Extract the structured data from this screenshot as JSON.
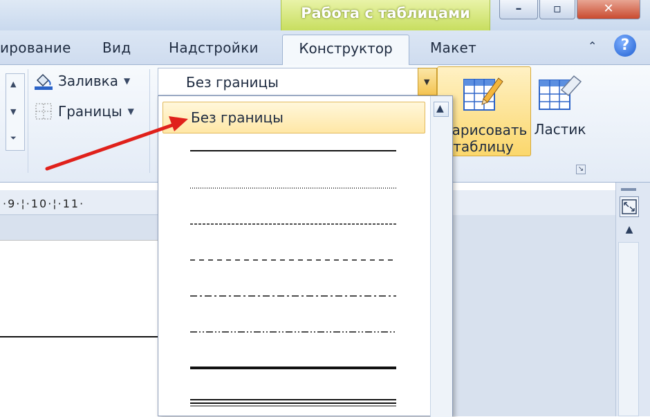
{
  "window": {
    "context_title": "Работа с таблицами",
    "minimize_glyph": "–",
    "restore_glyph": "▫",
    "close_glyph": "✕"
  },
  "tabs": [
    {
      "label": "ирование"
    },
    {
      "label": "Вид"
    },
    {
      "label": "Надстройки"
    },
    {
      "label": "Конструктор",
      "active": true
    },
    {
      "label": "Макет"
    }
  ],
  "ribbon": {
    "shading_label": "Заливка",
    "borders_label": "Границы",
    "line_style_value": "Без границы",
    "draw_table_label_line1": "арисовать",
    "draw_table_label_line2": "таблицу",
    "eraser_label": "Ластик"
  },
  "ruler": {
    "labels": "·9·¦·10·¦·11·"
  },
  "dropdown": {
    "selected_label": "Без границы",
    "line_styles": [
      "solid",
      "dotted",
      "dense-dash",
      "dash",
      "dash-dot",
      "dash-dot-dot",
      "thick",
      "double"
    ]
  },
  "colors": {
    "accent_context": "#c6dd5c",
    "arrow": "#e0211b",
    "hover": "#ffe7a6"
  }
}
